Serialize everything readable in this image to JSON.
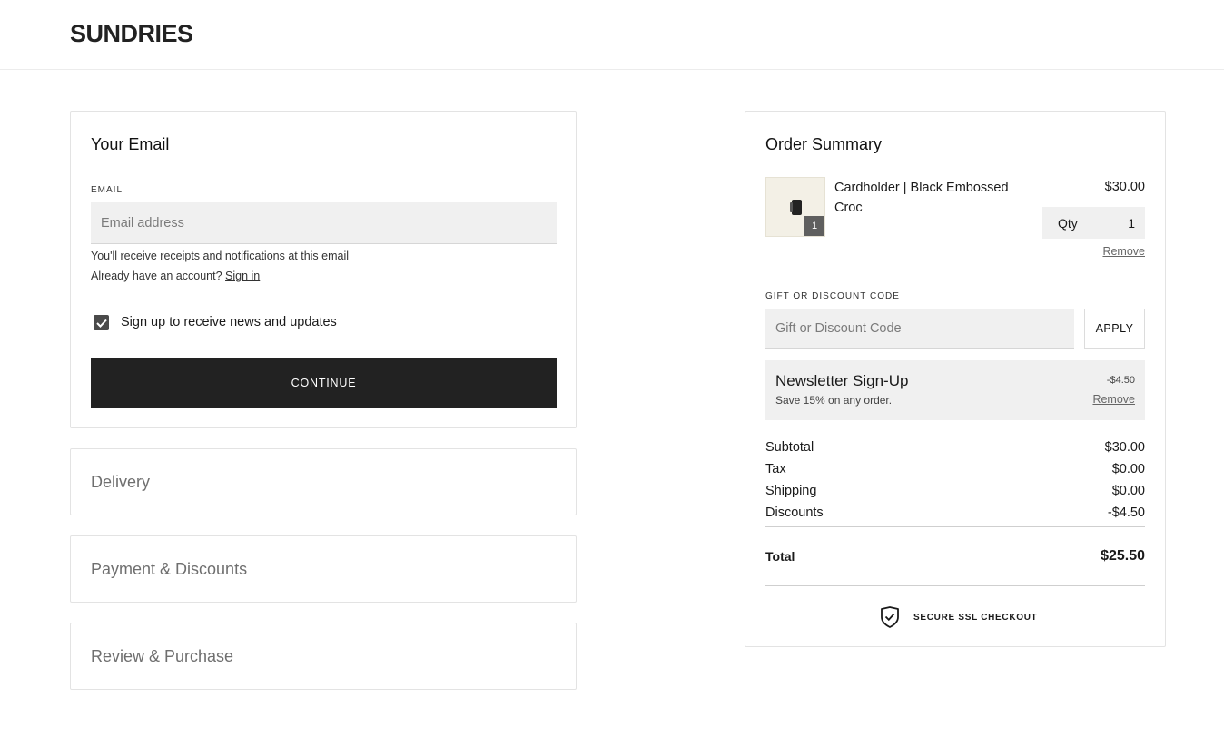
{
  "brand": {
    "logo_text": "SUNDRIES"
  },
  "email_section": {
    "title": "Your Email",
    "field_label": "EMAIL",
    "input_value": "",
    "input_placeholder": "Email address",
    "helper_text": "You'll receive receipts and notifications at this email",
    "account_prompt": "Already have an account?",
    "sign_in_link": "Sign in",
    "newsletter_checkbox": {
      "label": "Sign up to receive news and updates",
      "checked": true
    },
    "continue_label": "CONTINUE"
  },
  "steps": [
    {
      "title": "Delivery"
    },
    {
      "title": "Payment & Discounts"
    },
    {
      "title": "Review & Purchase"
    }
  ],
  "order_summary": {
    "title": "Order Summary",
    "item": {
      "name": "Cardholder | Black Embossed Croc",
      "price": "$30.00",
      "qty_label": "Qty",
      "qty_value": "1",
      "badge_count": "1",
      "remove_label": "Remove"
    },
    "discount_code": {
      "label": "GIFT OR DISCOUNT CODE",
      "input_value": "",
      "input_placeholder": "Gift or Discount Code",
      "apply_label": "APPLY"
    },
    "applied_discount": {
      "title": "Newsletter Sign-Up",
      "description": "Save 15% on any order.",
      "amount": "-$4.50",
      "remove_label": "Remove"
    },
    "totals": [
      {
        "label": "Subtotal",
        "value": "$30.00"
      },
      {
        "label": "Tax",
        "value": "$0.00"
      },
      {
        "label": "Shipping",
        "value": "$0.00"
      },
      {
        "label": "Discounts",
        "value": "-$4.50"
      }
    ],
    "total": {
      "label": "Total",
      "value": "$25.50"
    },
    "secure_text": "SECURE SSL CHECKOUT"
  },
  "icons": {
    "checkbox": "check-icon",
    "secure": "shield-check-icon"
  },
  "colors": {
    "primary_button": "#222222",
    "input_bg": "#f0f0f0",
    "border": "#e3e3e3",
    "muted_text": "#6f6f6f"
  }
}
